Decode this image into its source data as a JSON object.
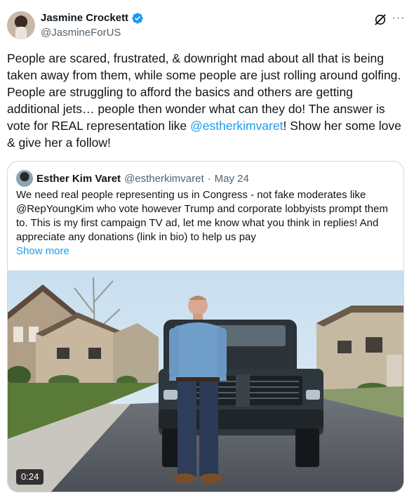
{
  "author": {
    "display_name": "Jasmine Crockett",
    "handle": "@JasmineForUS",
    "verified": true
  },
  "icons": {
    "grok": "grok-icon",
    "more": "more-dots-icon",
    "verified": "verified-badge-icon"
  },
  "tweet": {
    "text_before": "People are scared, frustrated, & downright mad about all that is being taken away from them, while some people are just rolling around golfing. People are struggling to afford the basics and others are getting additional jets… people then wonder what can they do! The answer is vote for REAL representation like ",
    "mention": "@estherkimvaret",
    "text_after": "! Show her some love & give her a follow!"
  },
  "quote": {
    "display_name": "Esther Kim Varet",
    "handle": "@estherkimvaret",
    "separator": "·",
    "date": "May 24",
    "text": "We need real people representing us in Congress - not fake moderates like @RepYoungKim who vote however Trump and corporate lobbyists prompt them to. This is my first campaign TV ad, let me know what you think in replies! And appreciate any donations (link in bio) to help us pay",
    "show_more": "Show more",
    "video_duration": "0:24"
  },
  "colors": {
    "link": "#1d9bf0",
    "secondary_text": "#536471",
    "border": "#cfd9de",
    "verified": "#1d9bf0"
  }
}
